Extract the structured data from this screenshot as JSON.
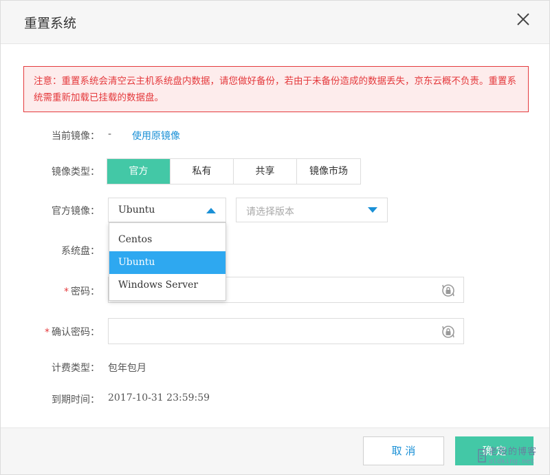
{
  "dialog": {
    "title": "重置系统"
  },
  "warning": {
    "text": "注意：重置系统会清空云主机系统盘内数据，请您做好备份，若由于未备份造成的数据丢失，京东云概不负责。重置系统需重新加载已挂载的数据盘。"
  },
  "current_image": {
    "label": "当前镜像：",
    "value": "-",
    "link": "使用原镜像"
  },
  "image_type": {
    "label": "镜像类型：",
    "tabs": [
      {
        "label": "官方",
        "active": true
      },
      {
        "label": "私有",
        "active": false
      },
      {
        "label": "共享",
        "active": false
      },
      {
        "label": "镜像市场",
        "active": false
      }
    ]
  },
  "official_image": {
    "label": "官方镜像：",
    "selected": "Ubuntu",
    "version_placeholder": "请选择版本",
    "options": [
      "Centos",
      "Ubuntu",
      "Windows Server"
    ],
    "selected_index": 1
  },
  "system_disk": {
    "label": "系统盘："
  },
  "password": {
    "required_mark": "*",
    "label": "密码："
  },
  "confirm_password": {
    "required_mark": "*",
    "label": "确认密码："
  },
  "billing": {
    "label": "计费类型：",
    "value": "包年包月"
  },
  "expiry": {
    "label": "到期时间：",
    "value": "2017-10-31 23:59:59"
  },
  "footer": {
    "cancel_label": "取 消",
    "ok_label": "确 定"
  },
  "watermark": {
    "text": "老殁的博客",
    "url": "oldking.net"
  },
  "colors": {
    "accent_green": "#43c8a6",
    "link_blue": "#1a90d6",
    "warning_red": "#e4393c",
    "dropdown_selected": "#2ea8f0"
  },
  "icons": {
    "close": "close-icon",
    "arrow_up": "caret-up-icon",
    "arrow_down": "caret-down-icon",
    "lock": "lock-refresh-icon"
  }
}
